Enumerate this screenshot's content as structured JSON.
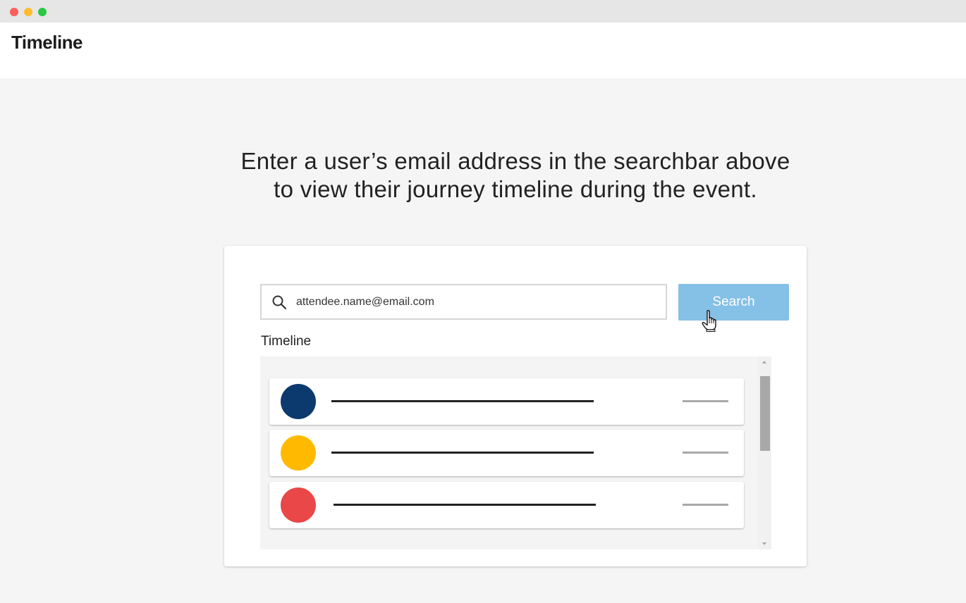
{
  "window": {
    "controls": [
      "close",
      "minimize",
      "maximize"
    ],
    "control_colors": {
      "close": "#fe5f57",
      "minimize": "#febc2e",
      "maximize": "#28c840"
    }
  },
  "header": {
    "title": "Timeline"
  },
  "main": {
    "instruction_line1": "Enter a user’s email address in the searchbar above",
    "instruction_line2": "to view their journey timeline during the event.",
    "illustration": {
      "search_value": "attendee.name@email.com",
      "search_button_label": "Search",
      "timeline_label": "Timeline",
      "accent_color": "#85c0e6",
      "items": [
        {
          "avatar_color": "#0d3a6e"
        },
        {
          "avatar_color": "#ffba00"
        },
        {
          "avatar_color": "#ea4748"
        }
      ]
    }
  }
}
